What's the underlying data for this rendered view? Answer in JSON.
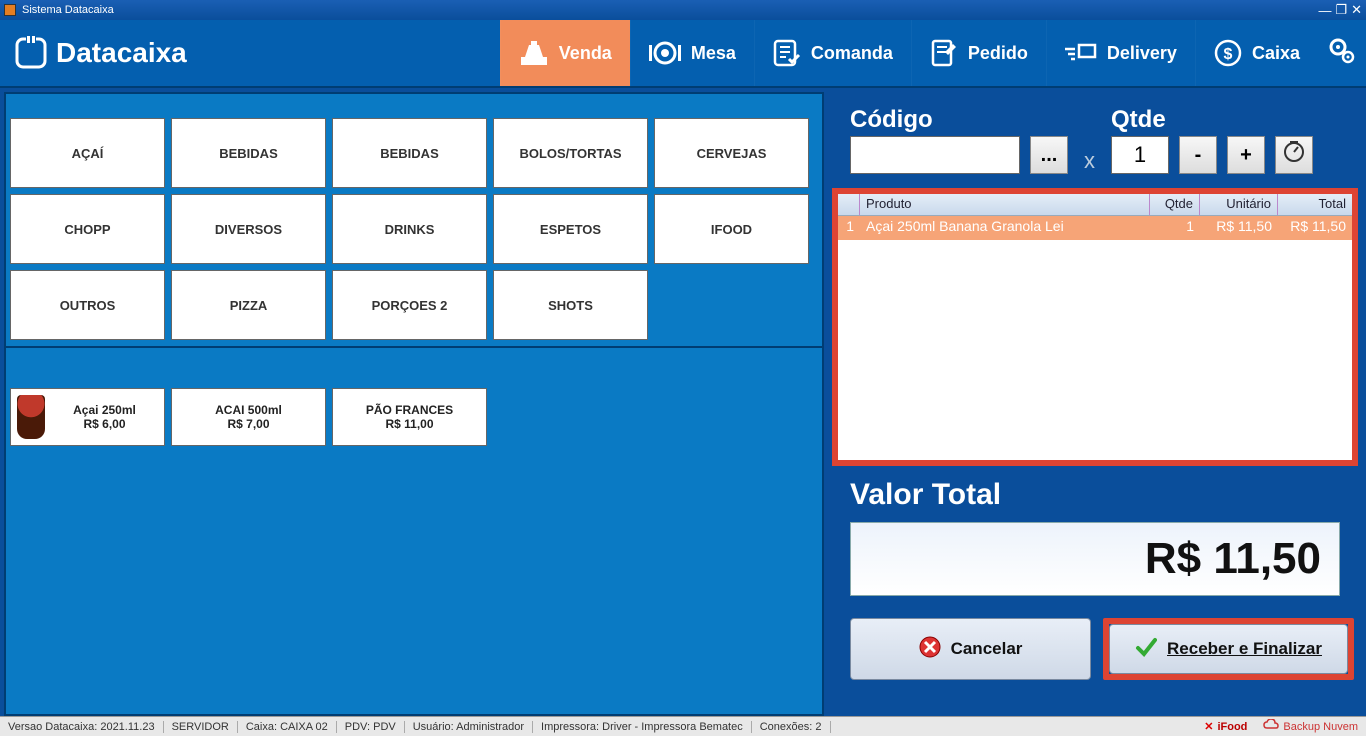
{
  "window": {
    "title": "Sistema Datacaixa"
  },
  "brand": "Datacaixa",
  "nav": {
    "venda": "Venda",
    "mesa": "Mesa",
    "comanda": "Comanda",
    "pedido": "Pedido",
    "delivery": "Delivery",
    "caixa": "Caixa"
  },
  "categories": [
    "AÇAÍ",
    "BEBIDAS",
    "BEBIDAS",
    "BOLOS/TORTAS",
    "CERVEJAS",
    "CHOPP",
    "DIVERSOS",
    "DRINKS",
    "ESPETOS",
    "IFOOD",
    "OUTROS",
    "PIZZA",
    "PORÇOES 2",
    "SHOTS"
  ],
  "products": [
    {
      "name": "Açai 250ml",
      "price": "R$ 6,00",
      "hasImage": true
    },
    {
      "name": "ACAI 500ml",
      "price": "R$ 7,00",
      "hasImage": false
    },
    {
      "name": "PÃO FRANCES",
      "price": "R$ 11,00",
      "hasImage": false
    }
  ],
  "entry": {
    "codigo_label": "Código",
    "codigo_value": "",
    "lookup": "...",
    "times": "x",
    "qtde_label": "Qtde",
    "qtde_value": "1",
    "minus": "-",
    "plus": "+"
  },
  "ticket": {
    "headers": {
      "produto": "Produto",
      "qtde": "Qtde",
      "unitario": "Unitário",
      "total": "Total"
    },
    "rows": [
      {
        "idx": "1",
        "produto": "Açai 250ml Banana Granola Lei",
        "qtde": "1",
        "unitario": "R$ 11,50",
        "total": "R$ 11,50"
      }
    ]
  },
  "total": {
    "label": "Valor Total",
    "value": "R$ 11,50"
  },
  "actions": {
    "cancel": "Cancelar",
    "finalize": "Receber e Finalizar"
  },
  "status": {
    "versao": "Versao Datacaixa: 2021.11.23",
    "servidor": "SERVIDOR",
    "caixa": "Caixa: CAIXA 02",
    "pdv": "PDV: PDV",
    "usuario": "Usuário: Administrador",
    "impressora": "Impressora: Driver - Impressora Bematec",
    "conexoes": "Conexões: 2",
    "ifood": "iFood",
    "backup": "Backup Nuvem"
  }
}
